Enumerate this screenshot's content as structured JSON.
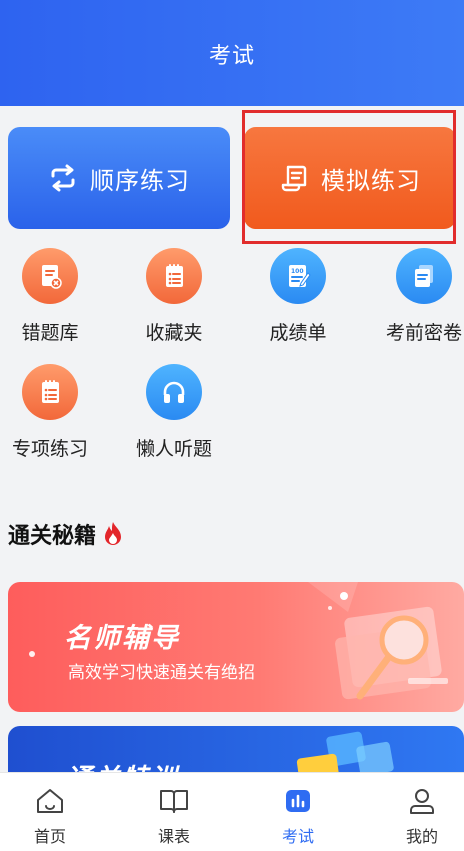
{
  "header": {
    "title": "考试"
  },
  "actions": {
    "sequential": "顺序练习",
    "mock": "模拟练习"
  },
  "tiles": [
    {
      "label": "错题库",
      "icon": "wrong-questions-icon"
    },
    {
      "label": "收藏夹",
      "icon": "favorites-icon"
    },
    {
      "label": "成绩单",
      "icon": "score-report-icon"
    },
    {
      "label": "考前密卷",
      "icon": "secret-paper-icon"
    },
    {
      "label": "专项练习",
      "icon": "special-practice-icon"
    },
    {
      "label": "懒人听题",
      "icon": "headphones-icon"
    }
  ],
  "section": {
    "title": "通关秘籍",
    "icon": "fire-icon"
  },
  "banners": [
    {
      "title": "名师辅导",
      "subtitle": "高效学习快速通关有绝招"
    },
    {
      "title": "通关特训"
    }
  ],
  "tabbar": [
    {
      "label": "首页",
      "icon": "home-icon"
    },
    {
      "label": "课表",
      "icon": "book-icon"
    },
    {
      "label": "考试",
      "icon": "exam-chart-icon",
      "active": true
    },
    {
      "label": "我的",
      "icon": "profile-icon"
    }
  ],
  "colors": {
    "primary": "#2f6cf2",
    "accent": "#f15a1d",
    "highlight_box": "#e12c2c"
  }
}
